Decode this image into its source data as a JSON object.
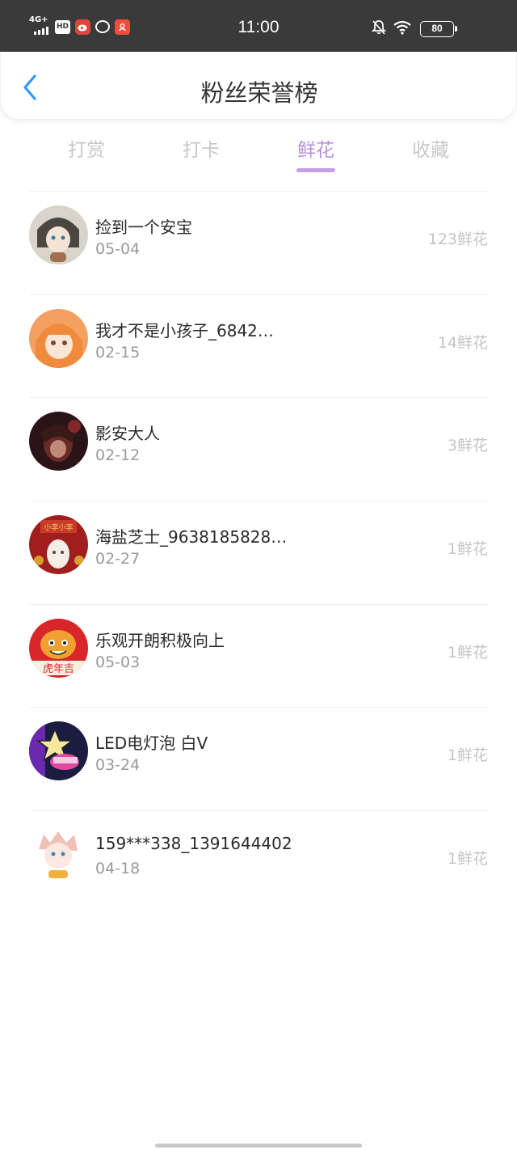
{
  "status_bar": {
    "network": "4G+",
    "hd": "HD",
    "time": "11:00",
    "battery": "80"
  },
  "header": {
    "title": "粉丝荣誉榜"
  },
  "tabs": [
    {
      "label": "打赏"
    },
    {
      "label": "打卡"
    },
    {
      "label": "鲜花"
    },
    {
      "label": "收藏"
    }
  ],
  "colors": {
    "active_tab": "#b690e0",
    "back_arrow": "#2d9cf0"
  },
  "fans": [
    {
      "name": "捡到一个安宝",
      "date": "05-04",
      "count": "123鲜花",
      "avatar": "avatar-1-icon"
    },
    {
      "name": "我才不是小孩子_6842…",
      "date": "02-15",
      "count": "14鲜花",
      "avatar": "avatar-2-icon"
    },
    {
      "name": "影安大人",
      "date": "02-12",
      "count": "3鲜花",
      "avatar": "avatar-3-icon"
    },
    {
      "name": "海盐芝士_9638185828…",
      "date": "02-27",
      "count": "1鲜花",
      "avatar": "avatar-4-icon"
    },
    {
      "name": "乐观开朗积极向上",
      "date": "05-03",
      "count": "1鲜花",
      "avatar": "avatar-5-icon"
    },
    {
      "name": "LED电灯泡 白V",
      "date": "03-24",
      "count": "1鲜花",
      "avatar": "avatar-6-icon"
    },
    {
      "name": "159***338_1391644402",
      "date": "04-18",
      "count": "1鲜花",
      "avatar": "avatar-7-icon"
    }
  ]
}
